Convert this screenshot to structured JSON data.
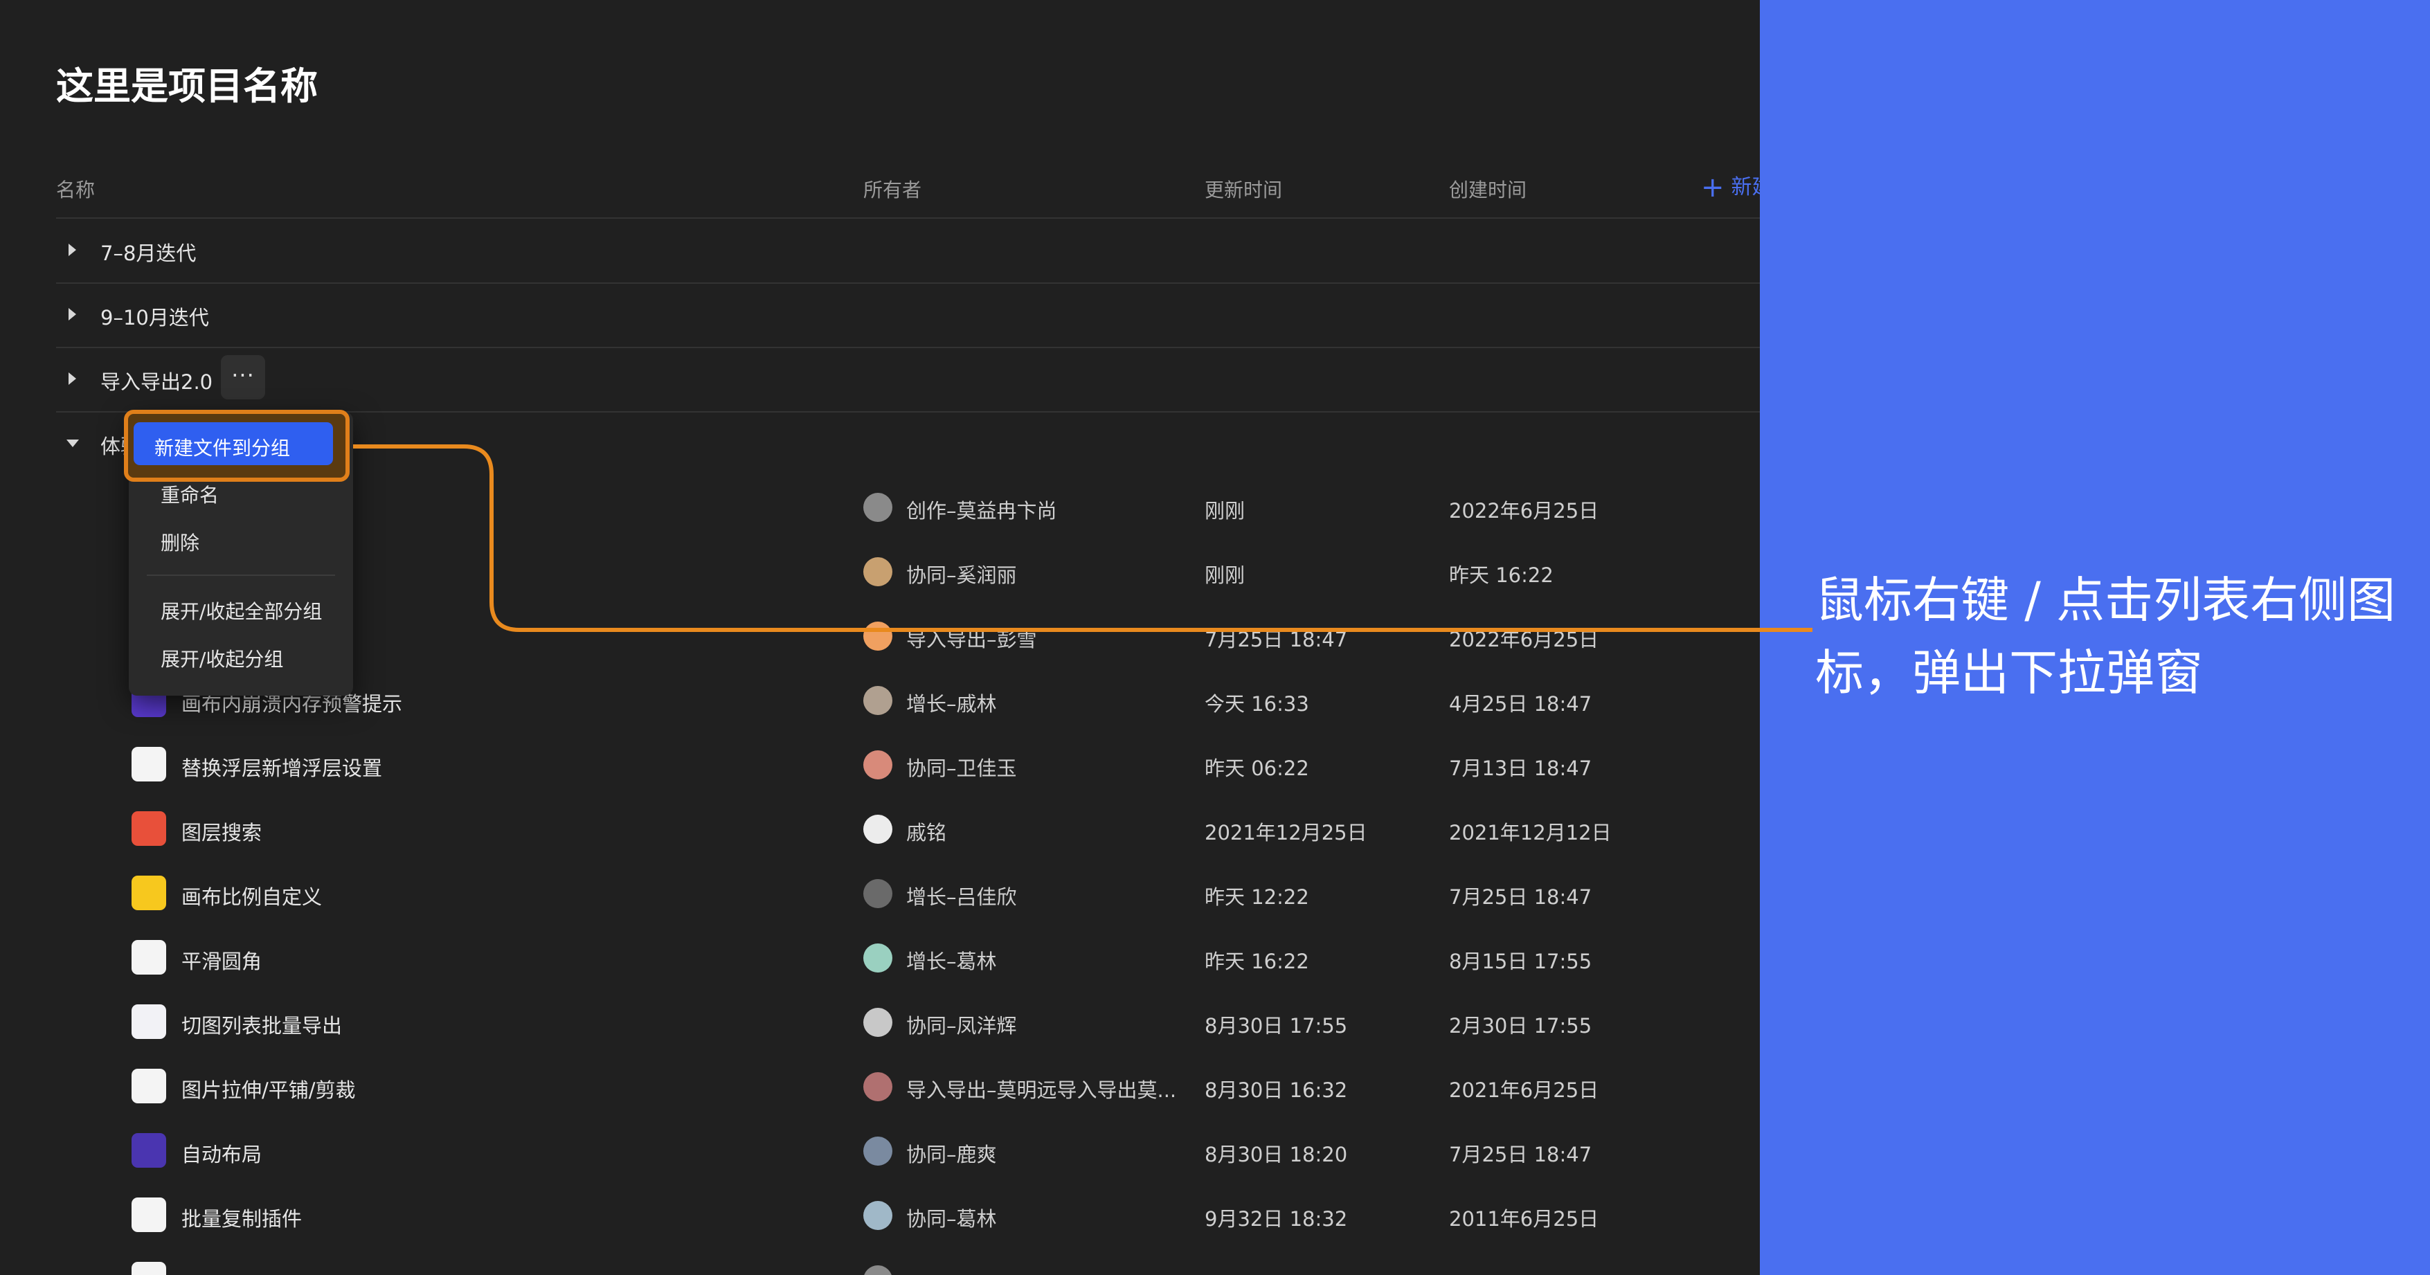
{
  "project_title": "这里是项目名称",
  "columns": {
    "name": "名称",
    "owner": "所有者",
    "updated": "更新时间",
    "created": "创建时间"
  },
  "new_button_label": "新建",
  "groups": [
    {
      "label": "7–8月迭代",
      "expanded": false
    },
    {
      "label": "9–10月迭代",
      "expanded": false
    },
    {
      "label": "导入导出2.0",
      "expanded": false
    },
    {
      "label": "体验",
      "expanded": true
    }
  ],
  "more_button_label": "···",
  "files": [
    {
      "name": "",
      "owner": "创作–莫益冉卞尚",
      "updated": "刚刚",
      "created": "2022年6月25日"
    },
    {
      "name": "",
      "owner": "协同–奚润丽",
      "updated": "刚刚",
      "created": "昨天 16:22"
    },
    {
      "name": "",
      "owner": "导入导出–彭雪",
      "updated": "7月25日 18:47",
      "created": "2022年6月25日"
    },
    {
      "name": "画布内崩溃内存预警提示",
      "owner": "增长–戚林",
      "updated": "今天 16:33",
      "created": "4月25日 18:47"
    },
    {
      "name": "替换浮层新增浮层设置",
      "owner": "协同–卫佳玉",
      "updated": "昨天 06:22",
      "created": "7月13日 18:47"
    },
    {
      "name": "图层搜索",
      "owner": "戚铭",
      "updated": "2021年12月25日",
      "created": "2021年12月12日"
    },
    {
      "name": "画布比例自定义",
      "owner": "增长–吕佳欣",
      "updated": "昨天 12:22",
      "created": "7月25日 18:47"
    },
    {
      "name": "平滑圆角",
      "owner": "增长–葛林",
      "updated": "昨天 16:22",
      "created": "8月15日 17:55"
    },
    {
      "name": "切图列表批量导出",
      "owner": "协同–凤洋辉",
      "updated": "8月30日 17:55",
      "created": "2月30日 17:55"
    },
    {
      "name": "图片拉伸/平铺/剪裁",
      "owner": "导入导出–莫明远导入导出莫...",
      "updated": "8月30日 16:32",
      "created": "2021年6月25日"
    },
    {
      "name": "自动布局",
      "owner": "协同–鹿爽",
      "updated": "8月30日 18:20",
      "created": "7月25日 18:47"
    },
    {
      "name": "批量复制插件",
      "owner": "协同–葛林",
      "updated": "9月32日 18:32",
      "created": "2011年6月25日"
    }
  ],
  "context_menu": {
    "items": [
      "新建文件到分组",
      "重命名",
      "删除",
      "展开/收起全部分组",
      "展开/收起分组"
    ],
    "highlighted_index": 0
  },
  "annotation_text": "鼠标右键 / 点击列表右侧图标，弹出下拉弹窗",
  "colors": {
    "background": "#202020",
    "panel": "#4a6ff0",
    "highlight": "#e07f1a",
    "accent": "#2f5ff0"
  }
}
